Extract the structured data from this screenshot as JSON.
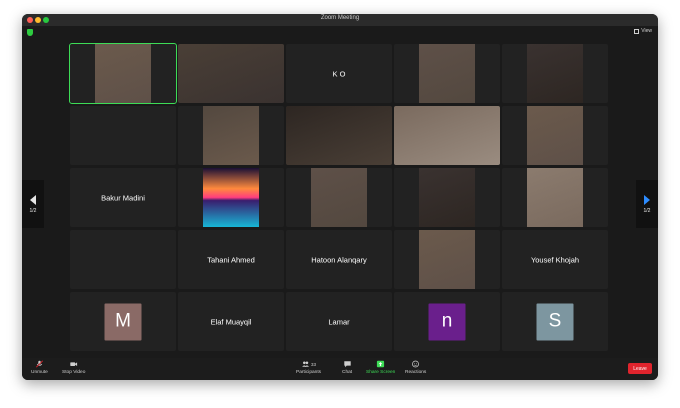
{
  "window": {
    "title": "Zoom Meeting",
    "view_label": "View"
  },
  "pager": {
    "left": "1/2",
    "right": "1/2"
  },
  "participants": [
    {
      "name": "",
      "type": "video"
    },
    {
      "name": "",
      "type": "video"
    },
    {
      "name": "K O",
      "type": "name"
    },
    {
      "name": "",
      "type": "video"
    },
    {
      "name": "",
      "type": "video"
    },
    {
      "name": "",
      "type": "empty"
    },
    {
      "name": "",
      "type": "video"
    },
    {
      "name": "",
      "type": "video"
    },
    {
      "name": "",
      "type": "video"
    },
    {
      "name": "",
      "type": "video"
    },
    {
      "name": "Bakur Madini",
      "type": "name"
    },
    {
      "name": "",
      "type": "image"
    },
    {
      "name": "",
      "type": "video"
    },
    {
      "name": "",
      "type": "video"
    },
    {
      "name": "",
      "type": "video"
    },
    {
      "name": "",
      "type": "empty"
    },
    {
      "name": "Tahani Ahmed",
      "type": "name"
    },
    {
      "name": "Hatoon Alanqary",
      "type": "name"
    },
    {
      "name": "",
      "type": "video"
    },
    {
      "name": "Yousef Khojah",
      "type": "name"
    },
    {
      "name": "",
      "type": "avatar",
      "letter": "M",
      "color": "#8a6a66"
    },
    {
      "name": "Elaf Muayqil",
      "type": "name"
    },
    {
      "name": "Lamar",
      "type": "name"
    },
    {
      "name": "",
      "type": "avatar",
      "letter": "n",
      "color": "#6a1f8c"
    },
    {
      "name": "",
      "type": "avatar",
      "letter": "S",
      "color": "#7d96a0"
    }
  ],
  "toolbar": {
    "unmute": "Unmute",
    "stop_video": "Stop Video",
    "participants": "Participants",
    "participants_count": "33",
    "chat": "Chat",
    "share_screen": "Share Screen",
    "reactions": "Reactions",
    "leave": "Leave"
  },
  "colors": {
    "accent_green": "#3ddc56",
    "leave_red": "#e0242d",
    "arrow_blue": "#2d8cff"
  }
}
